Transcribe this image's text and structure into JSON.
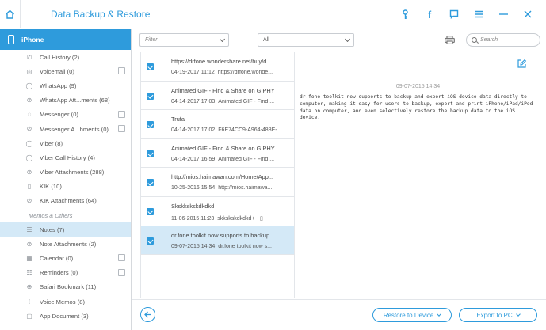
{
  "app": {
    "title": "Data Backup & Restore"
  },
  "colors": {
    "accent": "#2e9bdc",
    "selected_bg": "#d4e9f7"
  },
  "titlebar_icons": [
    "home-icon",
    "key-icon",
    "facebook-icon",
    "feedback-icon",
    "menu-icon",
    "minimize-icon",
    "close-icon"
  ],
  "sidebar": {
    "device_label": "iPhone",
    "device_checked": true,
    "section_label": "Memos & Others",
    "items_top": [
      {
        "label": "Call History (2)",
        "icon": "phone-icon",
        "checked": true
      },
      {
        "label": "Voicemail (0)",
        "icon": "voicemail-icon",
        "checked": false
      },
      {
        "label": "WhatsApp (9)",
        "icon": "whatsapp-icon",
        "checked": true
      },
      {
        "label": "WhatsApp Att...ments (68)",
        "icon": "attachment-icon",
        "checked": true
      },
      {
        "label": "Messenger (0)",
        "icon": "messenger-icon",
        "checked": false
      },
      {
        "label": "Messenger A...hments (0)",
        "icon": "attachment-icon",
        "checked": false
      },
      {
        "label": "Viber (8)",
        "icon": "viber-icon",
        "checked": true
      },
      {
        "label": "Viber Call History (4)",
        "icon": "viber-icon",
        "checked": true
      },
      {
        "label": "Viber Attachments (288)",
        "icon": "attachment-icon",
        "checked": true
      },
      {
        "label": "KIK (10)",
        "icon": "kik-icon",
        "checked": true
      },
      {
        "label": "KIK Attachments (64)",
        "icon": "attachment-icon",
        "checked": true
      }
    ],
    "items_bottom": [
      {
        "label": "Notes (7)",
        "icon": "notes-icon",
        "checked": true,
        "selected": true
      },
      {
        "label": "Note Attachments (2)",
        "icon": "attachment-icon",
        "checked": true
      },
      {
        "label": "Calendar (0)",
        "icon": "calendar-icon",
        "checked": false
      },
      {
        "label": "Reminders (0)",
        "icon": "reminders-icon",
        "checked": false
      },
      {
        "label": "Safari Bookmark (11)",
        "icon": "bookmark-icon",
        "checked": true
      },
      {
        "label": "Voice Memos (8)",
        "icon": "voice-memo-icon",
        "checked": true
      },
      {
        "label": "App Document (3)",
        "icon": "document-icon",
        "checked": true
      }
    ]
  },
  "toolbar": {
    "filter_placeholder": "Filter",
    "all_value": "All",
    "search_placeholder": "Search"
  },
  "messages": [
    {
      "title": "https://drfone.wondershare.net/buy/d...",
      "date": "04-19-2017 11:12",
      "preview": "https://drfone.wonde...",
      "checked": true
    },
    {
      "title": "Animated GIF - Find & Share on GIPHY",
      "date": "04-14-2017 17:03",
      "preview": "Animated GIF - Find ...",
      "checked": true
    },
    {
      "title": "Trufa",
      "date": "04-14-2017 17:02",
      "preview": "F6E74CC9-A964-488E-...",
      "checked": true
    },
    {
      "title": "Animated GIF - Find & Share on GIPHY",
      "date": "04-14-2017 16:59",
      "preview": "Animated GIF - Find ...",
      "checked": true
    },
    {
      "title": "http://mios.haimawan.com/Home/App...",
      "date": "10-25-2016 15:54",
      "preview": "http://mios.haimawa...",
      "checked": true
    },
    {
      "title": "Skskkskskdkdkd",
      "date": "11-06-2015 11:23",
      "preview": "skkskskdkdkd+ﾠ▯",
      "checked": true
    },
    {
      "title": "dr.fone toolkit now supports to backup...",
      "date": "09-07-2015 14:34",
      "preview": "dr.fone toolkit now s...",
      "checked": true,
      "selected": true
    }
  ],
  "detail": {
    "date": "09-07-2015 14:34",
    "text": "dr.fone toolkit now supports to backup and export iOS device data directly to computer, making it easy for users to backup, export and print iPhone/iPad/iPod data on computer, and even selectively restore the backup data to the iOS device."
  },
  "bottom": {
    "restore_label": "Restore to Device",
    "export_label": "Export to PC"
  }
}
